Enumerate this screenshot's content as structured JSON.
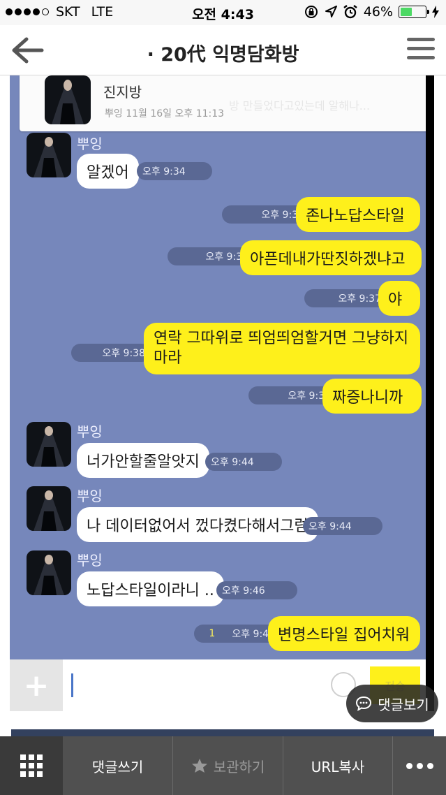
{
  "status_bar": {
    "carrier": "SKT",
    "network": "LTE",
    "time": "오전 4:43",
    "battery": "46%",
    "battery_level": 0.46
  },
  "nav": {
    "title": "· 20代 익명담화방"
  },
  "chat": {
    "notice": {
      "name": "진지방",
      "meta": "뿌잉 11월 16일 오후 11:13",
      "ghost_text": "방 만들었다고있는데 알해나..."
    },
    "messages": [
      {
        "side": "left",
        "sender": "뿌잉",
        "text": "알겠어",
        "time": "오후 9:34"
      },
      {
        "side": "right",
        "text": "존나노답스타일",
        "time": "오후 9:37"
      },
      {
        "side": "right",
        "text": "아픈데내가딴짓하겠냐고",
        "time": "오후 9:37"
      },
      {
        "side": "right",
        "text": "야",
        "time": "오후 9:37"
      },
      {
        "side": "right",
        "text": "연락 그따위로 띄엄띄엄할거면 그냥하지마라",
        "time": "오후 9:38"
      },
      {
        "side": "right",
        "text": "짜증나니까",
        "time": "오후 9:38"
      },
      {
        "side": "left",
        "sender": "뿌잉",
        "text": "너가안할줄알앗지",
        "time": "오후 9:44"
      },
      {
        "side": "left",
        "sender": "뿌잉",
        "text": "나 데이터없어서 껐다켰다해서그럼",
        "time": "오후 9:44"
      },
      {
        "side": "left",
        "sender": "뿌잉",
        "text": "노답스타일이라니 ..",
        "time": "오후 9:46"
      },
      {
        "side": "right",
        "text": "변명스타일 집어치워",
        "time": "오후 9:48",
        "unread": "1"
      }
    ],
    "send_label": "전송"
  },
  "comments_button": "댓글보기",
  "toolbar": {
    "write_comment": "댓글쓰기",
    "bookmark": "보관하기",
    "copy_url": "URL복사"
  }
}
